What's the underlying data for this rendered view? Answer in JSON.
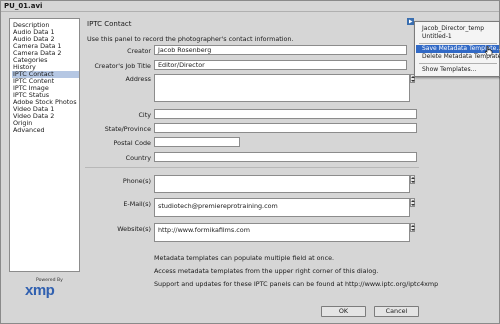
{
  "window": {
    "title": "PU_01.avi"
  },
  "sidebar": {
    "items": [
      {
        "label": "Description"
      },
      {
        "label": "Audio Data 1"
      },
      {
        "label": "Audio Data 2"
      },
      {
        "label": "Camera Data 1"
      },
      {
        "label": "Camera Data 2"
      },
      {
        "label": "Categories"
      },
      {
        "label": "History"
      },
      {
        "label": "IPTC Contact",
        "selected": true
      },
      {
        "label": "IPTC Content"
      },
      {
        "label": "IPTC Image"
      },
      {
        "label": "IPTC Status"
      },
      {
        "label": "Adobe Stock Photos"
      },
      {
        "label": "Video Data 1"
      },
      {
        "label": "Video Data 2"
      },
      {
        "label": "Origin"
      },
      {
        "label": "Advanced"
      }
    ],
    "logo": {
      "powered_by": "Powered By",
      "word": "xmp"
    }
  },
  "panel": {
    "title": "IPTC Contact",
    "description": "Use this panel to record the photographer's contact information.",
    "fields": {
      "creator": {
        "label": "Creator",
        "value": "Jacob Rosenberg"
      },
      "job_title": {
        "label": "Creator's Job Title",
        "value": "Editor/Director"
      },
      "address": {
        "label": "Address",
        "value": ""
      },
      "city": {
        "label": "City",
        "value": ""
      },
      "state": {
        "label": "State/Province",
        "value": ""
      },
      "postal": {
        "label": "Postal Code",
        "value": ""
      },
      "country": {
        "label": "Country",
        "value": ""
      },
      "phone": {
        "label": "Phone(s)",
        "value": ""
      },
      "email": {
        "label": "E-Mail(s)",
        "value": "studiotech@premiereprotraining.com"
      },
      "website": {
        "label": "Website(s)",
        "value": "http://www.formikafilms.com"
      }
    },
    "info_lines": [
      "Metadata templates can populate multiple field at once.",
      "Access metadata templates from the upper right corner of this dialog.",
      "Support and updates for these IPTC panels can be found at http://www.iptc.org/iptc4xmp"
    ]
  },
  "template_menu": {
    "items": [
      "Jacob_Director_temp",
      "Untitled-1",
      "Save Metadata Template...",
      "Delete Metadata Template...",
      "Show Templates..."
    ],
    "highlighted_index": 2
  },
  "buttons": {
    "ok": "OK",
    "cancel": "Cancel"
  }
}
